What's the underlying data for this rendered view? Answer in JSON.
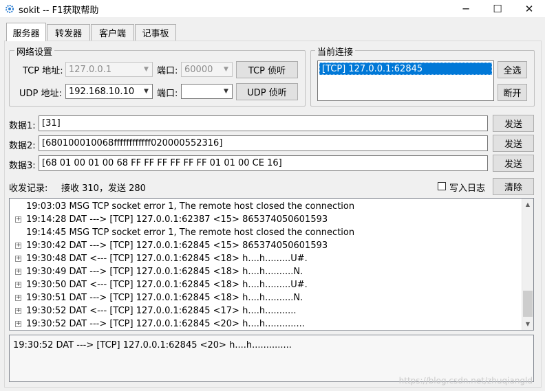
{
  "window": {
    "title": "sokit -- F1获取帮助",
    "minimize_glyph": "─",
    "maximize_glyph": "☐",
    "close_glyph": "✕",
    "icon": "gear-icon"
  },
  "tabs": [
    {
      "label": "服务器",
      "active": true
    },
    {
      "label": "转发器",
      "active": false
    },
    {
      "label": "客户端",
      "active": false
    },
    {
      "label": "记事板",
      "active": false
    }
  ],
  "network": {
    "group_title": "网络设置",
    "tcp_label": "TCP 地址:",
    "tcp_address": "127.0.0.1",
    "tcp_port_label": "端口:",
    "tcp_port": "60000",
    "tcp_listen": "TCP 侦听",
    "udp_label": "UDP 地址:",
    "udp_address": "192.168.10.10",
    "udp_port_label": "端口:",
    "udp_port": "",
    "udp_listen": "UDP 侦听"
  },
  "connections": {
    "group_title": "当前连接",
    "items": [
      "[TCP] 127.0.0.1:62845"
    ],
    "select_all": "全选",
    "disconnect": "断开"
  },
  "data_rows": [
    {
      "label": "数据1:",
      "value": "[31]",
      "send": "发送"
    },
    {
      "label": "数据2:",
      "value": "[680100010068ffffffffffff020000552316]",
      "send": "发送"
    },
    {
      "label": "数据3:",
      "value": "[68 01 00 01 00 68 FF FF FF FF FF FF 01 01 00 CE 16]",
      "send": "发送"
    }
  ],
  "records": {
    "label": "收发记录:",
    "stats": "接收 310，发送 280",
    "write_log_label": "写入日志",
    "write_log_checked": false,
    "clear": "清除"
  },
  "log_lines": [
    {
      "expandable": false,
      "text": "19:03:03 MSG TCP socket error 1, The remote host closed the connection"
    },
    {
      "expandable": true,
      "text": "19:14:28 DAT ---> [TCP] 127.0.0.1:62387 <15> 865374050601593"
    },
    {
      "expandable": false,
      "text": "19:14:45 MSG TCP socket error 1, The remote host closed the connection"
    },
    {
      "expandable": true,
      "text": "19:30:42 DAT ---> [TCP] 127.0.0.1:62845 <15> 865374050601593"
    },
    {
      "expandable": true,
      "text": "19:30:48 DAT <--- [TCP] 127.0.0.1:62845 <18> h....h.........U#."
    },
    {
      "expandable": true,
      "text": "19:30:49 DAT ---> [TCP] 127.0.0.1:62845 <18> h....h..........N."
    },
    {
      "expandable": true,
      "text": "19:30:50 DAT <--- [TCP] 127.0.0.1:62845 <18> h....h.........U#."
    },
    {
      "expandable": true,
      "text": "19:30:51 DAT ---> [TCP] 127.0.0.1:62845 <18> h....h..........N."
    },
    {
      "expandable": true,
      "text": "19:30:52 DAT <--- [TCP] 127.0.0.1:62845 <17> h....h..........."
    },
    {
      "expandable": true,
      "text": "19:30:52 DAT ---> [TCP] 127.0.0.1:62845 <20> h....h.............."
    }
  ],
  "detail_text": "19:30:52 DAT ---> [TCP] 127.0.0.1:62845 <20> h....h..............",
  "watermark": "https://blog.csdn.net/zhuqiangld",
  "colors": {
    "selection": "#0078d7",
    "panel": "#f0f0f0"
  }
}
